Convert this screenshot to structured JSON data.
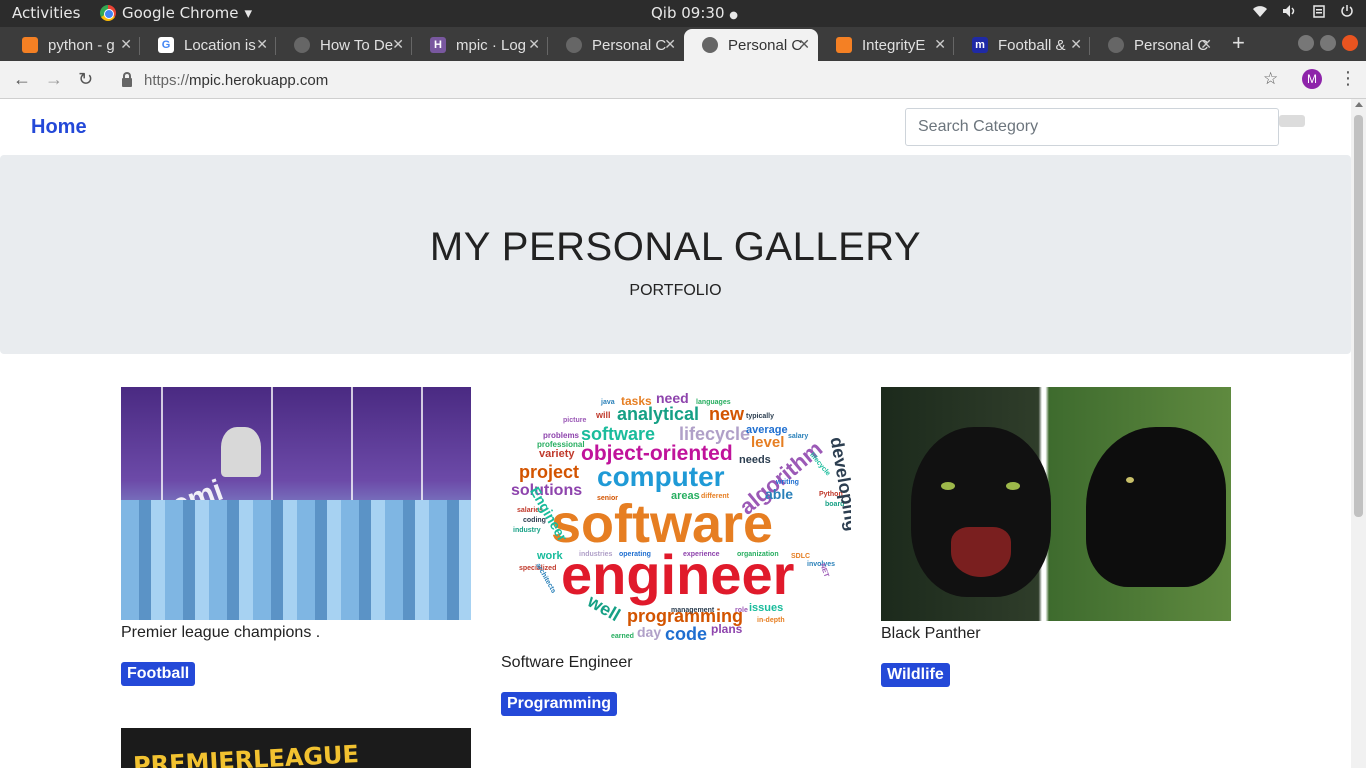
{
  "system_bar": {
    "activities": "Activities",
    "app_name": "Google Chrome",
    "app_menu_arrow": "▾",
    "clock": "Qib 09:30",
    "clock_dot": "●",
    "tray_icons": [
      "wifi-icon",
      "volume-icon",
      "clipboard-icon",
      "power-icon"
    ]
  },
  "tabs": [
    {
      "title": "python - g",
      "favicon": "stackoverflow-icon",
      "active": false
    },
    {
      "title": "Location is",
      "favicon": "google-icon",
      "active": false
    },
    {
      "title": "How To De",
      "favicon": "globe-icon",
      "active": false
    },
    {
      "title": "mpic · Log",
      "favicon": "heroku-icon",
      "active": false
    },
    {
      "title": "Personal C",
      "favicon": "globe-icon",
      "active": false
    },
    {
      "title": "Personal C",
      "favicon": "globe-icon",
      "active": true
    },
    {
      "title": "IntegrityE",
      "favicon": "stackoverflow-icon",
      "active": false
    },
    {
      "title": "Football &",
      "favicon": "mpic-icon",
      "active": false
    },
    {
      "title": "Personal C",
      "favicon": "globe-icon",
      "active": false
    }
  ],
  "toolbar": {
    "url": "https://mpic.herokuapp.com",
    "url_scheme": "https://",
    "url_host": "mpic.herokuapp.com",
    "profile_initial": "M",
    "back_icon": "←",
    "forward_icon": "→",
    "reload_icon": "↻",
    "star_icon": "☆",
    "menu_icon": "⋮",
    "new_tab_icon": "+"
  },
  "navbar": {
    "home_label": "Home",
    "search_placeholder": "Search Category",
    "search_value": ""
  },
  "jumbotron": {
    "title": "MY PERSONAL GALLERY",
    "subtitle": "PORTFOLIO"
  },
  "gallery": [
    {
      "caption": "Premier league champions .",
      "category": "Football",
      "image": "premier-league-trophy-photo",
      "image_text": "Premi"
    },
    {
      "caption": "Software Engineer",
      "category": "Programming",
      "image": "software-engineer-word-cloud"
    },
    {
      "caption": "Black Panther",
      "category": "Wildlife",
      "image": "black-panther-photo"
    },
    {
      "caption": "",
      "category": "",
      "image": "premier-league-banner",
      "image_text": "PREMIERLEAGUE"
    }
  ],
  "word_cloud": [
    "need",
    "languages",
    "tasks",
    "java",
    "will",
    "analytical",
    "new",
    "typically",
    "picture",
    "software",
    "lifecycle",
    "average",
    "problems",
    "professional",
    "level",
    "salary",
    "variety",
    "object-oriented",
    "project",
    "needs",
    "algorithm",
    "lifecycle",
    "computer",
    "writing",
    "solutions",
    "areas",
    "different",
    "able",
    "Python",
    "board",
    "software",
    "coding",
    "engineer",
    "work",
    "industries",
    "operating",
    "experience",
    "organization",
    "SDLC",
    "involves",
    "specialized",
    "well",
    "programming",
    "management",
    "role",
    "issues",
    "day",
    "code",
    "plans",
    "earned",
    "in-depth",
    "architects",
    "salaries",
    "industry",
    "senior",
    "developing",
    "NET",
    "Engineer"
  ],
  "colors": {
    "link": "#2449d8",
    "badge_bg": "#2449d8",
    "jumbotron_bg": "#e9ecef",
    "tabstrip_bg": "#3c3c3c",
    "topbar_bg": "#2c2c2c"
  }
}
